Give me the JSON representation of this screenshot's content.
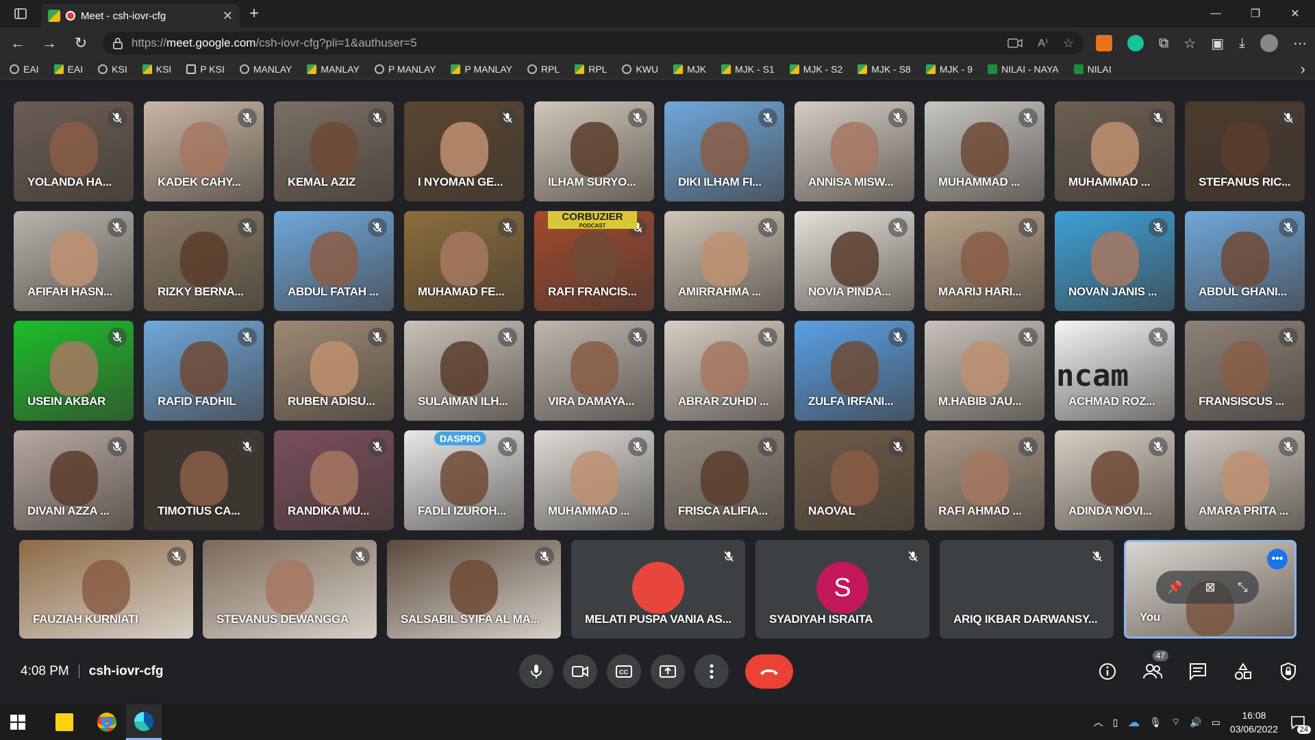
{
  "browser": {
    "tab_title": "Meet - csh-iovr-cfg",
    "url_prefix": "https://",
    "url_host": "meet.google.com",
    "url_path": "/csh-iovr-cfg?pli=1&authuser=5"
  },
  "bookmarks": [
    {
      "label": "EAI",
      "icon": "circle"
    },
    {
      "label": "EAI",
      "icon": "g"
    },
    {
      "label": "KSI",
      "icon": "circle"
    },
    {
      "label": "KSI",
      "icon": "g"
    },
    {
      "label": "P KSI",
      "icon": "p"
    },
    {
      "label": "MANLAY",
      "icon": "circle"
    },
    {
      "label": "MANLAY",
      "icon": "g"
    },
    {
      "label": "P MANLAY",
      "icon": "circle"
    },
    {
      "label": "P MANLAY",
      "icon": "g"
    },
    {
      "label": "RPL",
      "icon": "circle"
    },
    {
      "label": "RPL",
      "icon": "g"
    },
    {
      "label": "KWU",
      "icon": "circle"
    },
    {
      "label": "MJK",
      "icon": "g"
    },
    {
      "label": "MJK - S1",
      "icon": "g"
    },
    {
      "label": "MJK - S2",
      "icon": "g"
    },
    {
      "label": "MJK - S8",
      "icon": "g"
    },
    {
      "label": "MJK - 9",
      "icon": "g"
    },
    {
      "label": "NILAI - NAYA",
      "icon": "n"
    },
    {
      "label": "NILAI",
      "icon": "n"
    }
  ],
  "participants_grid": [
    [
      "YOLANDA HA...",
      "KADEK CAHY...",
      "KEMAL AZIZ",
      "I NYOMAN GE...",
      "ILHAM SURYO...",
      "DIKI ILHAM FI...",
      "ANNISA MISW...",
      "MUHAMMAD ...",
      "MUHAMMAD ...",
      "STEFANUS RIC..."
    ],
    [
      "AFIFAH HASN...",
      "RIZKY BERNA...",
      "ABDUL FATAH ...",
      "MUHAMAD FE...",
      "RAFI FRANCIS...",
      "AMIRRAHMA ...",
      "NOVIA PINDA...",
      "MAARIJ HARI...",
      "NOVAN JANIS ...",
      "ABDUL GHANI..."
    ],
    [
      "USEIN AKBAR",
      "RAFID FADHIL",
      "RUBEN ADISU...",
      "SULAIMAN ILH...",
      "VIRA DAMAYA...",
      "ABRAR ZUHDI ...",
      "ZULFA IRFANI...",
      "M.HABIB JAU...",
      "ACHMAD ROZ...",
      "FRANSISCUS ..."
    ],
    [
      "DIVANI AZZA ...",
      "TIMOTIUS CA...",
      "RANDIKA MU...",
      "FADLI IZUROH...",
      "MUHAMMAD ...",
      "FRISCA ALIFIA...",
      "NAOVAL",
      "RAFI AHMAD ...",
      "ADINDA NOVI...",
      "AMARA PRITA ..."
    ]
  ],
  "tile_overlays": {
    "corbuzier_sign": "CORBUZIER",
    "corbuzier_sub": "PODCAST",
    "ncam": "ncam",
    "daspro": "DASPRO"
  },
  "bottom_row": [
    {
      "name": "FAUZIAH KURNIATI",
      "type": "video"
    },
    {
      "name": "STEVANUS DEWANGGA",
      "type": "video"
    },
    {
      "name": "SALSABIL SYIFA AL MA...",
      "type": "video"
    },
    {
      "name": "MELATI PUSPA VANIA AS...",
      "type": "avatar",
      "avatar_color": "#e8453c"
    },
    {
      "name": "SYADIYAH ISRAITA",
      "type": "letter",
      "letter": "S",
      "avatar_color": "#c2185b"
    },
    {
      "name": "ARIQ IKBAR DARWANSY...",
      "type": "avatar",
      "avatar_color": "#3c4043"
    }
  ],
  "self_tile": {
    "name": "You"
  },
  "meeting": {
    "time": "4:08 PM",
    "code": "csh-iovr-cfg",
    "participant_count": "47"
  },
  "taskbar": {
    "time": "16:08",
    "date": "03/06/2022",
    "notifications": "24"
  },
  "colors": {
    "end_call": "#ea4335",
    "accent": "#8ab4f8",
    "background": "#202124"
  }
}
